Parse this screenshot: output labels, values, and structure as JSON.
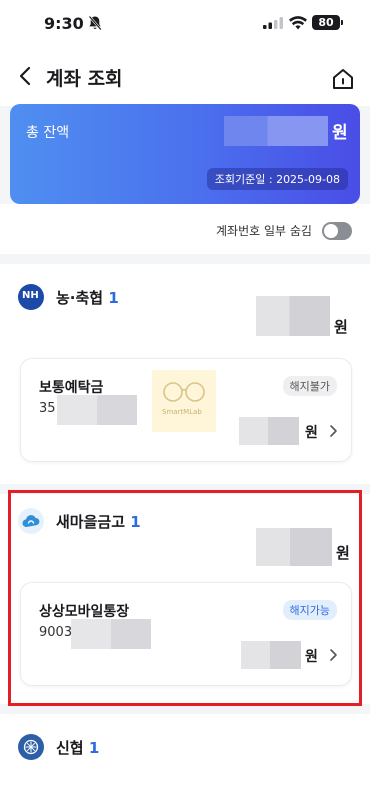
{
  "status_bar": {
    "time": "9:30",
    "battery": "80"
  },
  "header": {
    "title": "계좌 조회"
  },
  "summary": {
    "label": "총 잔액",
    "currency": "원",
    "date": "조회기준일 : 2025-09-08"
  },
  "toggle": {
    "label": "계좌번호 일부 숨김",
    "on": false
  },
  "banks": [
    {
      "logo_text": "NH",
      "name": "농·축협",
      "count": "1",
      "currency": "원",
      "account": {
        "name": "보통예탁금",
        "number_prefix": "35",
        "badge": "해지불가",
        "currency": "원"
      }
    },
    {
      "name": "새마을금고",
      "count": "1",
      "currency": "원",
      "account": {
        "name": "상상모바일통장",
        "number_prefix": "9003",
        "badge": "해지가능",
        "currency": "원"
      }
    },
    {
      "name": "신협",
      "count": "1"
    }
  ],
  "watermark": {
    "text": "SmartMLab"
  },
  "colors": {
    "accent": "#2d6be0",
    "highlight": "#e21f26",
    "card_gradient_start": "#4f8ff0",
    "card_gradient_end": "#4a4de6"
  }
}
